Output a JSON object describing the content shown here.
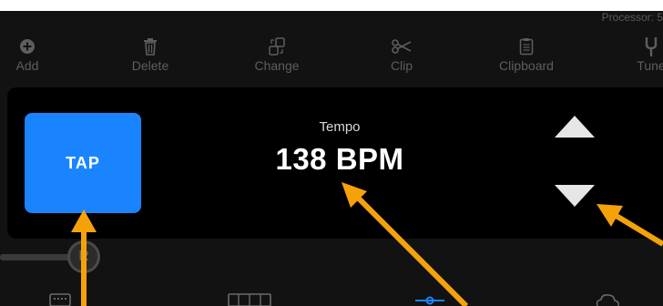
{
  "status": {
    "processor_text": "Processor: 5"
  },
  "toolbar": {
    "items": [
      {
        "label": "Add",
        "icon": "plus-circle-icon"
      },
      {
        "label": "Delete",
        "icon": "trash-icon"
      },
      {
        "label": "Change",
        "icon": "swap-icon"
      },
      {
        "label": "Clip",
        "icon": "scissors-icon"
      },
      {
        "label": "Clipboard",
        "icon": "clipboard-icon"
      },
      {
        "label": "Tune",
        "icon": "tuning-fork-icon"
      }
    ]
  },
  "tempo": {
    "title": "Tempo",
    "value": "138 BPM",
    "tap_label": "TAP",
    "up_icon": "triangle-up-icon",
    "down_icon": "triangle-down-icon"
  },
  "knob": {
    "label": "R"
  },
  "colors": {
    "accent": "#1a84ff",
    "annotation_arrow": "#f5a20a",
    "panel": "#000000",
    "background": "#121212"
  }
}
